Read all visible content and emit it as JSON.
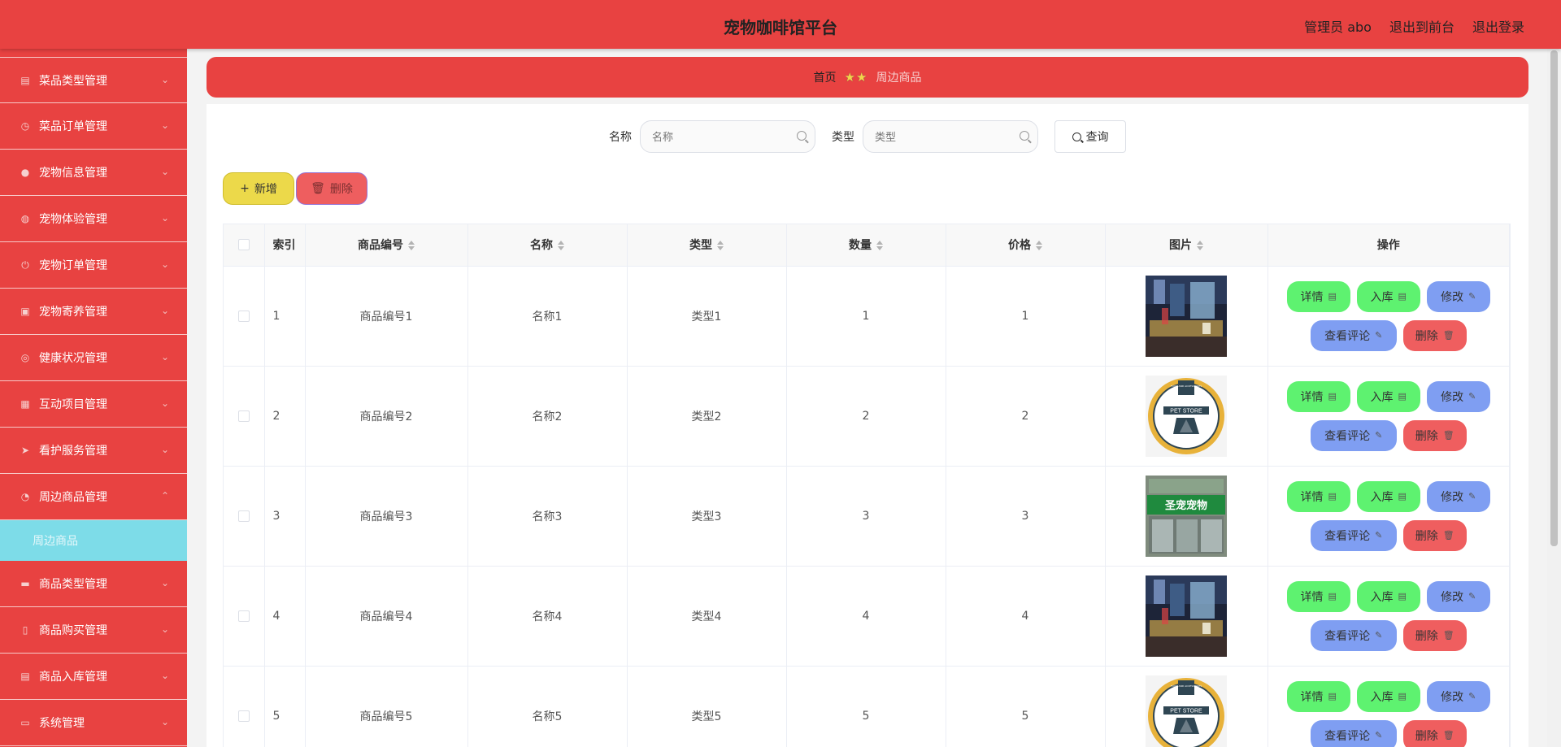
{
  "header": {
    "title": "宠物咖啡馆平台",
    "user_label": "管理员 abo",
    "back_front": "退出到前台",
    "logout": "退出登录"
  },
  "sidebar": {
    "items": [
      {
        "label": "菜品类型管理",
        "icon": "chart-icon"
      },
      {
        "label": "菜品订单管理",
        "icon": "clock-icon"
      },
      {
        "label": "宠物信息管理",
        "icon": "user-icon"
      },
      {
        "label": "宠物体验管理",
        "icon": "globe-icon"
      },
      {
        "label": "宠物订单管理",
        "icon": "power-icon"
      },
      {
        "label": "宠物寄养管理",
        "icon": "clipboard-icon"
      },
      {
        "label": "健康状况管理",
        "icon": "target-icon"
      },
      {
        "label": "互动项目管理",
        "icon": "grid-icon"
      },
      {
        "label": "看护服务管理",
        "icon": "send-icon"
      },
      {
        "label": "周边商品管理",
        "icon": "compass-icon"
      },
      {
        "label": "商品类型管理",
        "icon": "disk-icon"
      },
      {
        "label": "商品购买管理",
        "icon": "phone-icon"
      },
      {
        "label": "商品入库管理",
        "icon": "list-icon"
      },
      {
        "label": "系统管理",
        "icon": "chat-icon"
      }
    ],
    "active_sub": "周边商品"
  },
  "breadcrumb": {
    "home": "首页",
    "current": "周边商品"
  },
  "search": {
    "name_label": "名称",
    "name_placeholder": "名称",
    "type_label": "类型",
    "type_placeholder": "类型",
    "query_button": "查询"
  },
  "actions": {
    "add": "新增",
    "delete": "删除"
  },
  "table": {
    "headers": {
      "index": "索引",
      "code": "商品编号",
      "name": "名称",
      "type": "类型",
      "qty": "数量",
      "price": "价格",
      "image": "图片",
      "ops": "操作"
    },
    "rows": [
      {
        "index": "1",
        "code": "商品编号1",
        "name": "名称1",
        "type": "类型1",
        "qty": "1",
        "price": "1",
        "image": "store-interior"
      },
      {
        "index": "2",
        "code": "商品编号2",
        "name": "名称2",
        "type": "类型2",
        "qty": "2",
        "price": "2",
        "image": "pet-store-logo"
      },
      {
        "index": "3",
        "code": "商品编号3",
        "name": "名称3",
        "type": "类型3",
        "qty": "3",
        "price": "3",
        "image": "storefront"
      },
      {
        "index": "4",
        "code": "商品编号4",
        "name": "名称4",
        "type": "类型4",
        "qty": "4",
        "price": "4",
        "image": "store-interior"
      },
      {
        "index": "5",
        "code": "商品编号5",
        "name": "名称5",
        "type": "类型5",
        "qty": "5",
        "price": "5",
        "image": "pet-store-logo"
      }
    ],
    "op_labels": {
      "detail": "详情",
      "stock": "入库",
      "edit": "修改",
      "review": "查看评论",
      "remove": "删除"
    },
    "logo_text": {
      "top": "FOOD AND ACCESSORIES",
      "main": "PET STORE",
      "storefront_sign": "圣宠宠物"
    }
  },
  "colors": {
    "primary": "#e84241",
    "sub_active": "#7ddce8",
    "green": "#5ef270",
    "blue": "#7f9ef2",
    "red": "#ef5e5f",
    "yellow": "#ecd94a"
  }
}
